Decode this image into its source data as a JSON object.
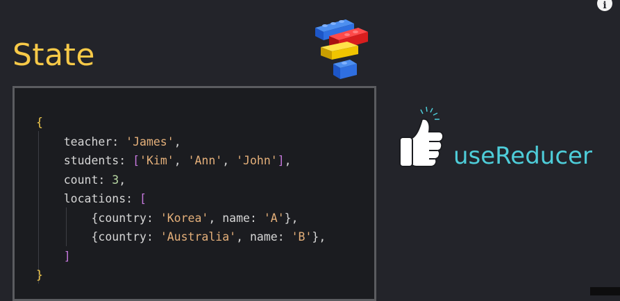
{
  "slide": {
    "title": "State",
    "hook_label": "useReducer",
    "info_icon_glyph": "i"
  },
  "icons": {
    "lego": "lego-bricks-icon",
    "thumb": "thumbs-up-icon",
    "info": "info-icon"
  },
  "colors": {
    "title": "#f7c948",
    "hook_label": "#4ecdd9",
    "background": "#23242a"
  },
  "code": {
    "lines": [
      [
        {
          "t": "{",
          "c": "punc-y"
        }
      ],
      [
        {
          "t": "    teacher: ",
          "c": "key"
        },
        {
          "t": "'James'",
          "c": "str"
        },
        {
          "t": ",",
          "c": "key"
        }
      ],
      [
        {
          "t": "    students: ",
          "c": "key"
        },
        {
          "t": "[",
          "c": "punc-p"
        },
        {
          "t": "'Kim'",
          "c": "str"
        },
        {
          "t": ", ",
          "c": "key"
        },
        {
          "t": "'Ann'",
          "c": "str"
        },
        {
          "t": ", ",
          "c": "key"
        },
        {
          "t": "'John'",
          "c": "str"
        },
        {
          "t": "]",
          "c": "punc-p"
        },
        {
          "t": ",",
          "c": "key"
        }
      ],
      [
        {
          "t": "    count: ",
          "c": "key"
        },
        {
          "t": "3",
          "c": "num"
        },
        {
          "t": ",",
          "c": "key"
        }
      ],
      [
        {
          "t": "    locations: ",
          "c": "key"
        },
        {
          "t": "[",
          "c": "punc-p"
        }
      ],
      [
        {
          "t": "        {country: ",
          "c": "key"
        },
        {
          "t": "'Korea'",
          "c": "str"
        },
        {
          "t": ", name: ",
          "c": "key"
        },
        {
          "t": "'A'",
          "c": "str"
        },
        {
          "t": "},",
          "c": "key"
        }
      ],
      [
        {
          "t": "        {country: ",
          "c": "key"
        },
        {
          "t": "'Australia'",
          "c": "str"
        },
        {
          "t": ", name: ",
          "c": "key"
        },
        {
          "t": "'B'",
          "c": "str"
        },
        {
          "t": "},",
          "c": "key"
        }
      ],
      [
        {
          "t": "    ]",
          "c": "punc-p"
        }
      ],
      [
        {
          "t": "}",
          "c": "punc-y"
        }
      ]
    ]
  }
}
